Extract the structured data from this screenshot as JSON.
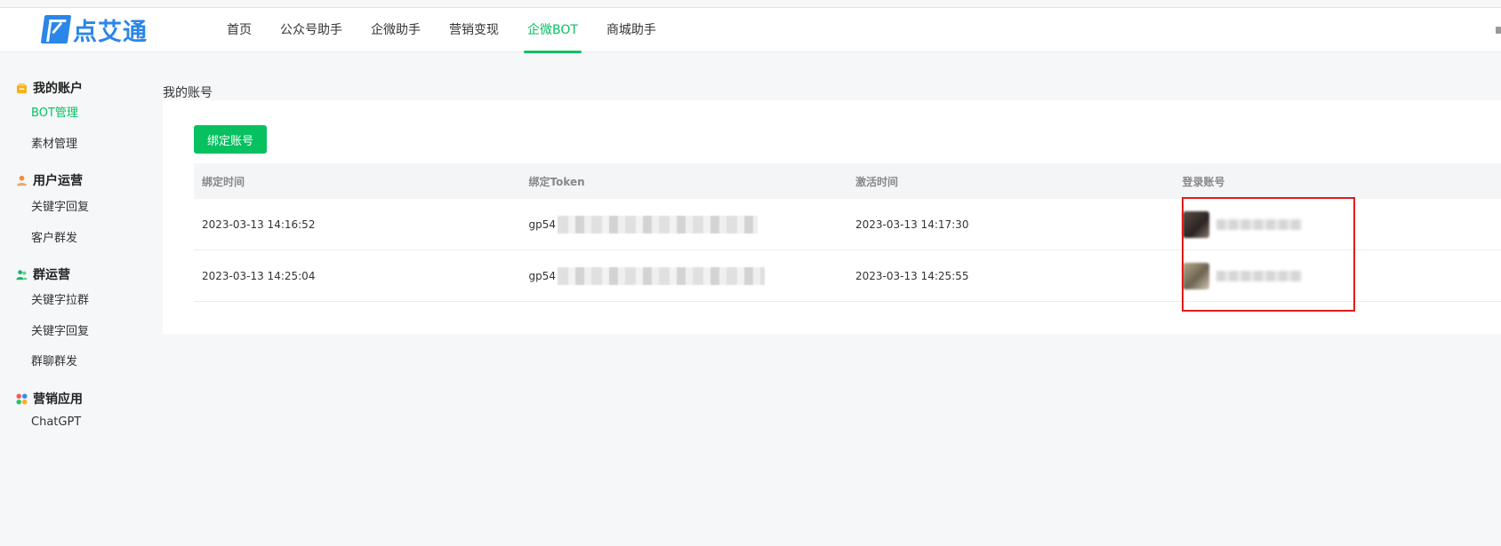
{
  "brand": {
    "name": "点艾通",
    "color": "#2a86e8",
    "accent": "#07c160"
  },
  "nav": {
    "items": [
      {
        "label": "首页",
        "active": false
      },
      {
        "label": "公众号助手",
        "active": false
      },
      {
        "label": "企微助手",
        "active": false
      },
      {
        "label": "营销变现",
        "active": false
      },
      {
        "label": "企微BOT",
        "active": true
      },
      {
        "label": "商城助手",
        "active": false
      }
    ]
  },
  "sidebar": {
    "groups": [
      {
        "title": "我的账户",
        "icon": "wallet-icon",
        "items": [
          {
            "label": "BOT管理",
            "active": true
          },
          {
            "label": "素材管理",
            "active": false
          }
        ]
      },
      {
        "title": "用户运营",
        "icon": "user-icon",
        "items": [
          {
            "label": "关键字回复",
            "active": false
          },
          {
            "label": "客户群发",
            "active": false
          }
        ]
      },
      {
        "title": "群运营",
        "icon": "group-icon",
        "items": [
          {
            "label": "关键字拉群",
            "active": false
          },
          {
            "label": "关键字回复",
            "active": false
          },
          {
            "label": "群聊群发",
            "active": false
          }
        ]
      },
      {
        "title": "营销应用",
        "icon": "apps-icon",
        "items": [
          {
            "label": "ChatGPT",
            "active": false
          }
        ]
      }
    ]
  },
  "main": {
    "page_title": "我的账号",
    "bind_button": "绑定账号",
    "table": {
      "headers": [
        "绑定时间",
        "绑定Token",
        "激活时间",
        "登录账号"
      ],
      "rows": [
        {
          "bind_time": "2023-03-13 14:16:52",
          "token_prefix": "gp54",
          "activate_time": "2023-03-13 14:17:30"
        },
        {
          "bind_time": "2023-03-13 14:25:04",
          "token_prefix": "gp54",
          "activate_time": "2023-03-13 14:25:55"
        }
      ]
    }
  }
}
